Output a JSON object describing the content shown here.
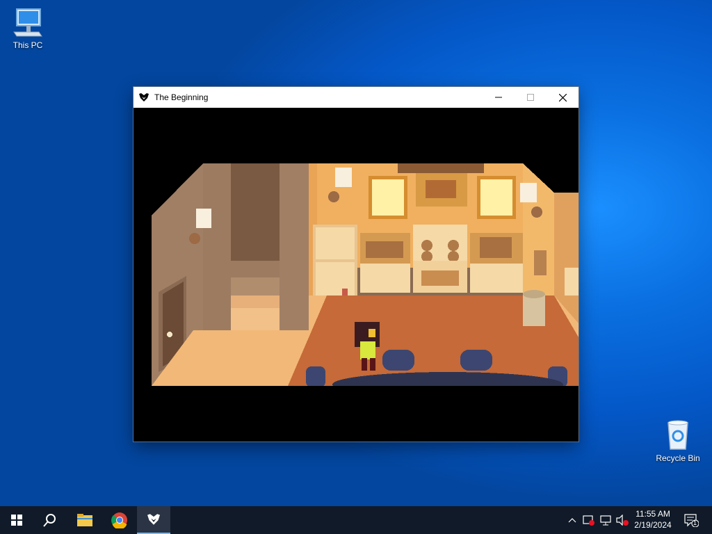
{
  "desktop": {
    "icons": [
      {
        "label": "This PC",
        "icon": "computer-icon"
      },
      {
        "label": "Recycle Bin",
        "icon": "recycle-bin-icon"
      }
    ]
  },
  "window": {
    "title": "The Beginning",
    "app_icon": "deltarune-icon",
    "controls": [
      "minimize-icon",
      "maximize-icon",
      "close-icon"
    ]
  },
  "taskbar": {
    "pinned": [
      "windows-start-icon",
      "search-icon",
      "file-explorer-icon",
      "chrome-icon",
      "deltarune-icon"
    ],
    "tray_icons": [
      "chevron-up-icon",
      "security-alert-icon",
      "network-icon",
      "volume-muted-icon"
    ],
    "time": "11:55 AM",
    "date": "2/19/2024",
    "notification_count": "1"
  },
  "colors": {
    "taskbar": "#101a28",
    "desktop_blue": "#0a6fe0",
    "kitchen_wall": "#f0b060",
    "floor": "#c56a38"
  }
}
